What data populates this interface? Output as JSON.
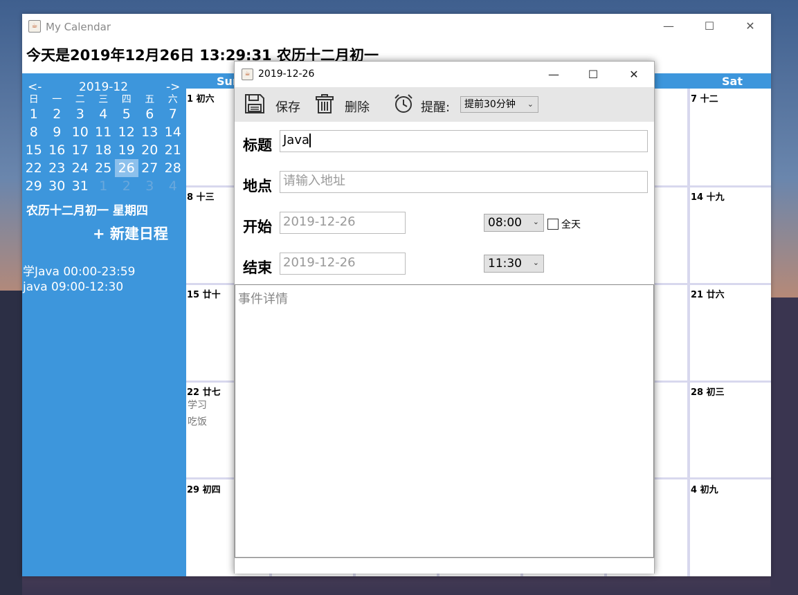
{
  "window": {
    "title": "My Calendar",
    "minimize": "—",
    "maximize": "☐",
    "close": "✕"
  },
  "header": {
    "today": "今天是2019年12月26日  13:29:31   农历十二月初一"
  },
  "mini_calendar": {
    "prev": "<-",
    "month": "2019-12",
    "next": "->",
    "weekdays": [
      "日",
      "一",
      "二",
      "三",
      "四",
      "五",
      "六"
    ],
    "weeks": [
      [
        "1",
        "2",
        "3",
        "4",
        "5",
        "6",
        "7"
      ],
      [
        "8",
        "9",
        "10",
        "11",
        "12",
        "13",
        "14"
      ],
      [
        "15",
        "16",
        "17",
        "18",
        "19",
        "20",
        "21"
      ],
      [
        "22",
        "23",
        "24",
        "25",
        "26",
        "27",
        "28"
      ],
      [
        "29",
        "30",
        "31",
        "1",
        "2",
        "3",
        "4"
      ]
    ],
    "selected": "26",
    "lunar_week": "农历十二月初一 星期四",
    "new_event": "+ 新建日程",
    "events": [
      "学Java 00:00-23:59",
      "java 09:00-12:30"
    ]
  },
  "calendar": {
    "sun_label": "Sun",
    "sat_label": "Sat",
    "sun_days": [
      {
        "label": "1 初六"
      },
      {
        "label": "8 十三"
      },
      {
        "label": "15 廿十"
      },
      {
        "label": "22 廿七",
        "events": [
          "学习",
          "吃饭"
        ]
      },
      {
        "label": "29 初四"
      }
    ],
    "sat_days": [
      {
        "label": "7 十二"
      },
      {
        "label": "14 十九"
      },
      {
        "label": "21 廿六"
      },
      {
        "label": "28 初三"
      },
      {
        "label": "4 初九"
      }
    ]
  },
  "dialog": {
    "title": "2019-12-26",
    "save": "保存",
    "delete": "删除",
    "reminder_label": "提醒:",
    "reminder_value": "提前30分钟",
    "title_label": "标题",
    "title_value": "Java",
    "location_label": "地点",
    "location_placeholder": "请输入地址",
    "start_label": "开始",
    "start_date": "2019-12-26",
    "start_time": "08:00",
    "all_day": "全天",
    "end_label": "结束",
    "end_date": "2019-12-26",
    "end_time": "11:30",
    "details_placeholder": "事件详情"
  }
}
